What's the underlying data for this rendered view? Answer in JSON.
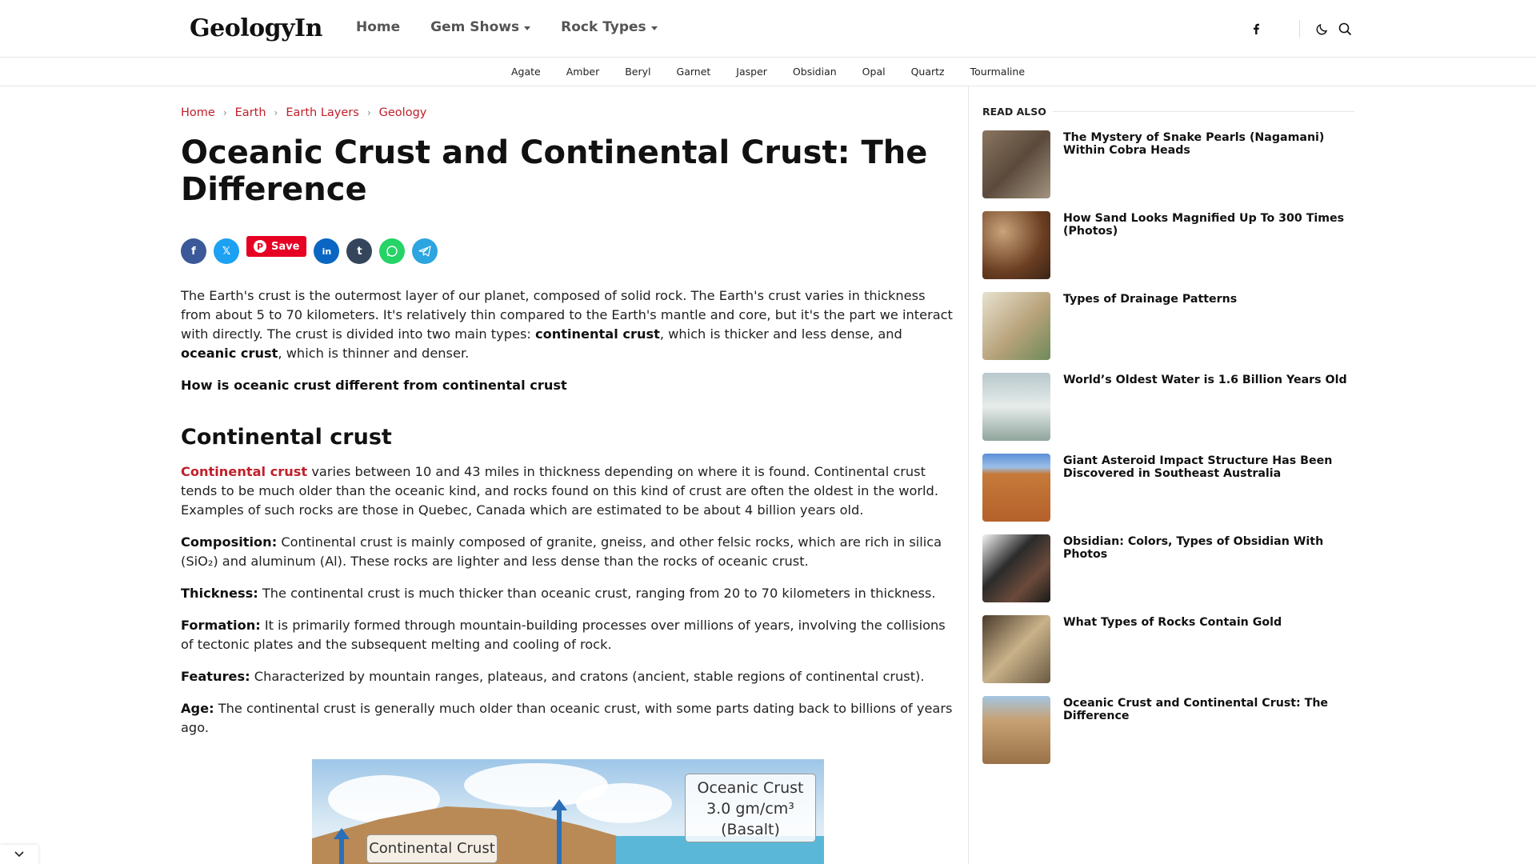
{
  "header": {
    "logo": "GeologyIn",
    "nav": [
      {
        "label": "Home"
      },
      {
        "label": "Gem Shows"
      },
      {
        "label": "Rock Types"
      }
    ],
    "icons": [
      "facebook-icon",
      "moon-icon",
      "search-icon"
    ]
  },
  "subnav": [
    "Agate",
    "Amber",
    "Beryl",
    "Garnet",
    "Jasper",
    "Obsidian",
    "Opal",
    "Quartz",
    "Tourmaline"
  ],
  "breadcrumb": [
    "Home",
    "Earth",
    "Earth Layers",
    "Geology"
  ],
  "article": {
    "title": "Oceanic Crust and Continental Crust: The Difference",
    "share": {
      "pin_label": "Save"
    },
    "intro_part1": "The Earth's crust is the outermost layer of our planet, composed of solid rock. The Earth's crust varies in thickness from about 5 to 70 kilometers. It's relatively thin compared to the Earth's mantle and core, but it's the part we interact with directly. The crust is divided into two main types: ",
    "intro_bold1": "continental crust",
    "intro_part2": ", which is thicker and less dense, and ",
    "intro_bold2": "oceanic crust",
    "intro_part3": ", which is thinner and denser.",
    "question": "How is oceanic crust different from continental crust",
    "h2": "Continental crust",
    "cc_link": "Continental crust",
    "cc_text": " varies between 10 and 43 miles in thickness depending on where it is found. Continental crust tends to be much older than the oceanic kind, and rocks found on this kind of crust are often the oldest in the world. Examples of such rocks are those in Quebec, Canada which are estimated to be about 4 billion years old.",
    "composition_label": "Composition:",
    "composition_text": " Continental crust is mainly composed of granite, gneiss, and other felsic rocks, which are rich in silica (SiO₂) and aluminum (Al). These rocks are lighter and less dense than the rocks of oceanic crust.",
    "thickness_label": "Thickness:",
    "thickness_text": " The continental crust is much thicker than oceanic crust, ranging from 20 to 70 kilometers in thickness.",
    "formation_label": "Formation:",
    "formation_text": " It is primarily formed through mountain-building processes over millions of years, involving the collisions of tectonic plates and the subsequent melting and cooling of rock.",
    "features_label": "Features:",
    "features_text": " Characterized by mountain ranges, plateaus, and cratons (ancient, stable regions of continental crust).",
    "age_label": "Age:",
    "age_text": " The continental crust is generally much older than oceanic crust, with some parts dating back to billions of years ago."
  },
  "figure": {
    "oceanic_label": "Oceanic Crust",
    "oceanic_density": "3.0 gm/cm³",
    "oceanic_rock": "(Basalt)",
    "continental_label": "Continental Crust"
  },
  "sidebar": {
    "heading": "READ ALSO",
    "items": [
      {
        "title": "The Mystery of Snake Pearls (Nagamani) Within Cobra Heads",
        "color": "#6b5a4a"
      },
      {
        "title": "How Sand Looks Magnified Up To 300 Times (Photos)",
        "color": "#7a5232"
      },
      {
        "title": "Types of Drainage Patterns",
        "color": "#b3a07a"
      },
      {
        "title": "World’s Oldest Water is 1.6 Billion Years Old",
        "color": "#9fb1ad"
      },
      {
        "title": "Giant Asteroid Impact Structure Has Been Discovered in Southeast Australia",
        "color": "#c6783a"
      },
      {
        "title": "Obsidian: Colors, Types of Obsidian With Photos",
        "color": "#3a3a3a"
      },
      {
        "title": "What Types of Rocks Contain Gold",
        "color": "#8a7a5a"
      },
      {
        "title": "Oceanic Crust and Continental Crust: The Difference",
        "color": "#b38a5e"
      }
    ]
  }
}
